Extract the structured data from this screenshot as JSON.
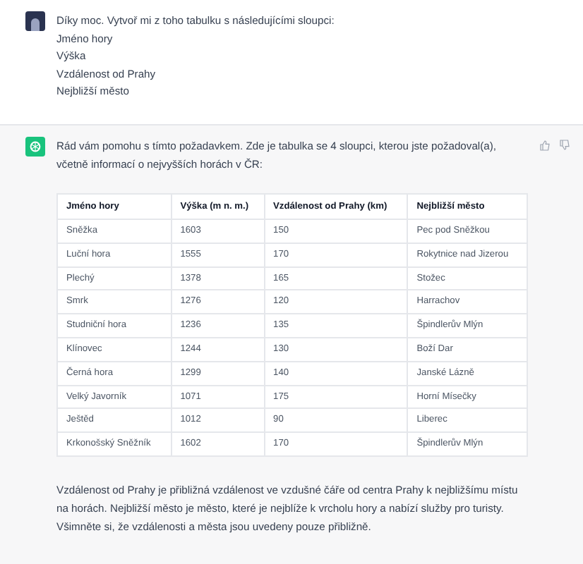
{
  "user_message": {
    "lines": [
      "Díky moc. Vytvoř mi z toho tabulku s následujícími sloupci:",
      "Jméno hory",
      "Výška",
      "Vzdálenost od Prahy",
      "Nejbližší město"
    ]
  },
  "assistant_message": {
    "intro": "Rád vám pomohu s tímto požadavkem. Zde je tabulka se 4 sloupci, kterou jste požadoval(a), včetně informací o nejvyšších horách v ČR:",
    "table": {
      "columns": [
        "Jméno hory",
        "Výška (m n. m.)",
        "Vzdálenost od Prahy (km)",
        "Nejbližší město"
      ],
      "rows": [
        [
          "Sněžka",
          "1603",
          "150",
          "Pec pod Sněžkou"
        ],
        [
          "Luční hora",
          "1555",
          "170",
          "Rokytnice nad Jizerou"
        ],
        [
          "Plechý",
          "1378",
          "165",
          "Stožec"
        ],
        [
          "Smrk",
          "1276",
          "120",
          "Harrachov"
        ],
        [
          "Studniční hora",
          "1236",
          "135",
          "Špindlerův Mlýn"
        ],
        [
          "Klínovec",
          "1244",
          "130",
          "Boží Dar"
        ],
        [
          "Černá hora",
          "1299",
          "140",
          "Janské Lázně"
        ],
        [
          "Velký Javorník",
          "1071",
          "175",
          "Horní Mísečky"
        ],
        [
          "Ještěd",
          "1012",
          "90",
          "Liberec"
        ],
        [
          "Krkonošský Sněžník",
          "1602",
          "170",
          "Špindlerův Mlýn"
        ]
      ]
    },
    "outro": "Vzdálenost od Prahy je přibližná vzdálenost ve vzdušné čáře od centra Prahy k nejbližšímu místu na horách. Nejbližší město je město, které je nejblíže k vrcholu hory a nabízí služby pro turisty. Všimněte si, že vzdálenosti a města jsou uvedeny pouze přibližně."
  }
}
